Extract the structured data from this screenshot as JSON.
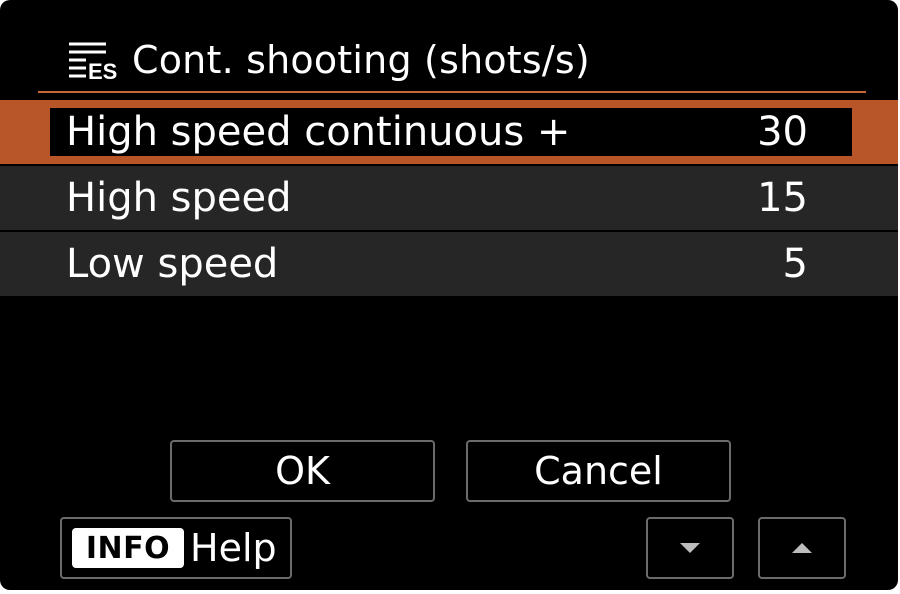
{
  "header": {
    "icon": "shooting-menu-icon",
    "title": "Cont. shooting (shots/s)"
  },
  "options": [
    {
      "label": "High speed continuous +",
      "value": "30",
      "selected": true
    },
    {
      "label": "High speed",
      "value": "15",
      "selected": false
    },
    {
      "label": "Low speed",
      "value": "5",
      "selected": false
    }
  ],
  "buttons": {
    "ok_label": "OK",
    "cancel_label": "Cancel"
  },
  "footer": {
    "info_badge": "INFO",
    "help_label": "Help",
    "down_icon": "triangle-down-icon",
    "up_icon": "triangle-up-icon"
  },
  "colors": {
    "background": "#000000",
    "accent": "#b8562a",
    "row_background": "#262626",
    "text": "#ffffff"
  }
}
